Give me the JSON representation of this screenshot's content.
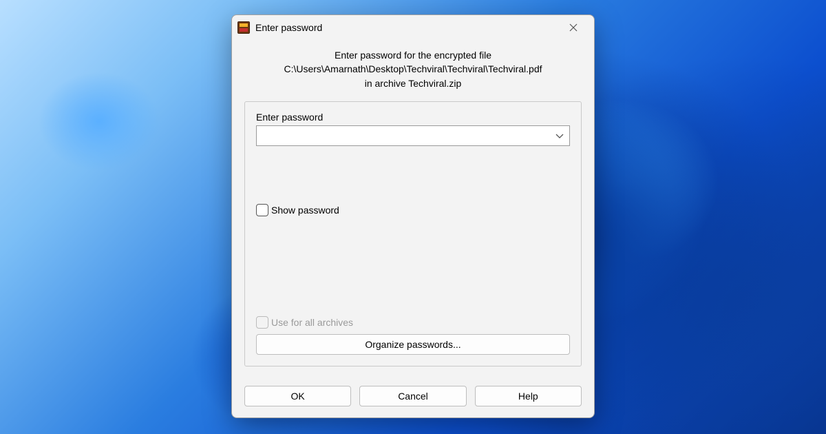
{
  "dialog": {
    "title": "Enter password",
    "prompt_line1": "Enter password for the encrypted file",
    "prompt_line2": "C:\\Users\\Amarnath\\Desktop\\Techviral\\Techviral\\Techviral.pdf",
    "prompt_line3": "in archive Techviral.zip",
    "password": {
      "label": "Enter password",
      "value": ""
    },
    "show_password": {
      "label": "Show password",
      "checked": false,
      "enabled": true
    },
    "use_for_all": {
      "label": "Use for all archives",
      "checked": false,
      "enabled": false
    },
    "organize_button": "Organize passwords...",
    "buttons": {
      "ok": "OK",
      "cancel": "Cancel",
      "help": "Help"
    }
  }
}
